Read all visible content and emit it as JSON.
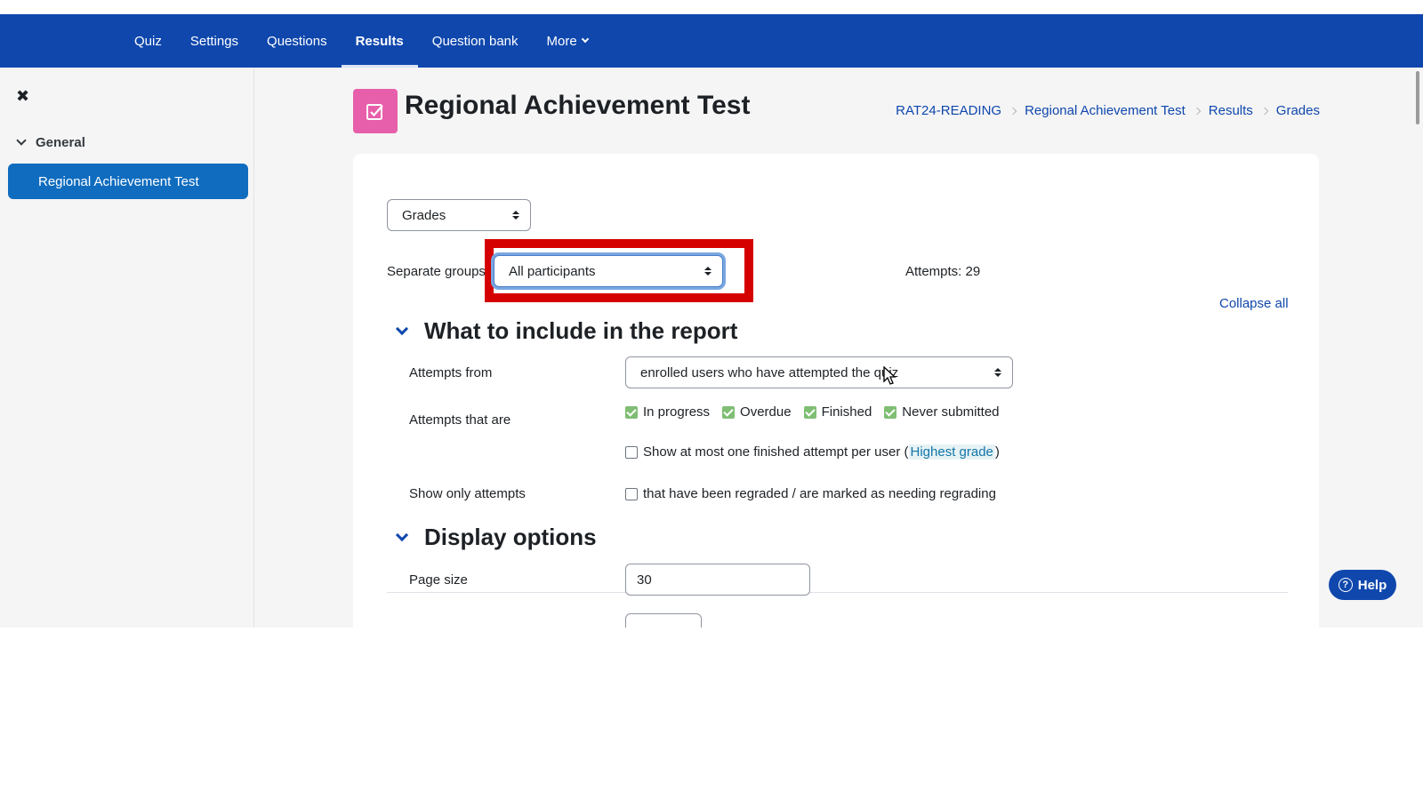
{
  "top_nav": {
    "tabs": [
      {
        "label": "Quiz"
      },
      {
        "label": "Settings"
      },
      {
        "label": "Questions"
      },
      {
        "label": "Results"
      },
      {
        "label": "Question bank"
      },
      {
        "label": "More"
      }
    ],
    "active_tab": "Results"
  },
  "sidebar": {
    "section_label": "General",
    "items": [
      {
        "label": "Regional Achievement Test",
        "active": true
      }
    ]
  },
  "page": {
    "title": "Regional Achievement Test",
    "breadcrumb": [
      "RAT24-READING",
      "Regional Achievement Test",
      "Results",
      "Grades"
    ]
  },
  "report": {
    "report_select": "Grades",
    "groups_label": "Separate groups",
    "groups_select": "All participants",
    "attempts_summary": "Attempts: 29",
    "collapse_all": "Collapse all"
  },
  "section_include": {
    "title": "What to include in the report",
    "attempts_from_label": "Attempts from",
    "attempts_from_value": "enrolled users who have attempted the quiz",
    "attempts_that_are_label": "Attempts that are",
    "states": [
      {
        "label": "In progress",
        "checked": true
      },
      {
        "label": "Overdue",
        "checked": true
      },
      {
        "label": "Finished",
        "checked": true
      },
      {
        "label": "Never submitted",
        "checked": true
      }
    ],
    "one_attempt_text": "Show at most one finished attempt per user",
    "one_attempt_link": "Highest grade",
    "one_attempt_checked": false,
    "show_only_label": "Show only attempts",
    "regraded_text": "that have been regraded / are marked as needing regrading",
    "regraded_checked": false
  },
  "section_display": {
    "title": "Display options",
    "page_size_label": "Page size",
    "page_size_value": "30"
  },
  "help_button": "Help",
  "colors": {
    "nav_bg": "#0f47ad",
    "active_side": "#0f6cbf",
    "module_icon": "#e75faa",
    "highlight_border": "#d50000",
    "checkbox_on": "#7fbe73"
  },
  "icons": [
    "close-icon",
    "chevron-down-icon",
    "quiz-module-icon",
    "select-arrows-icon",
    "breadcrumb-chevron-icon",
    "help-icon",
    "mouse-cursor-icon"
  ]
}
